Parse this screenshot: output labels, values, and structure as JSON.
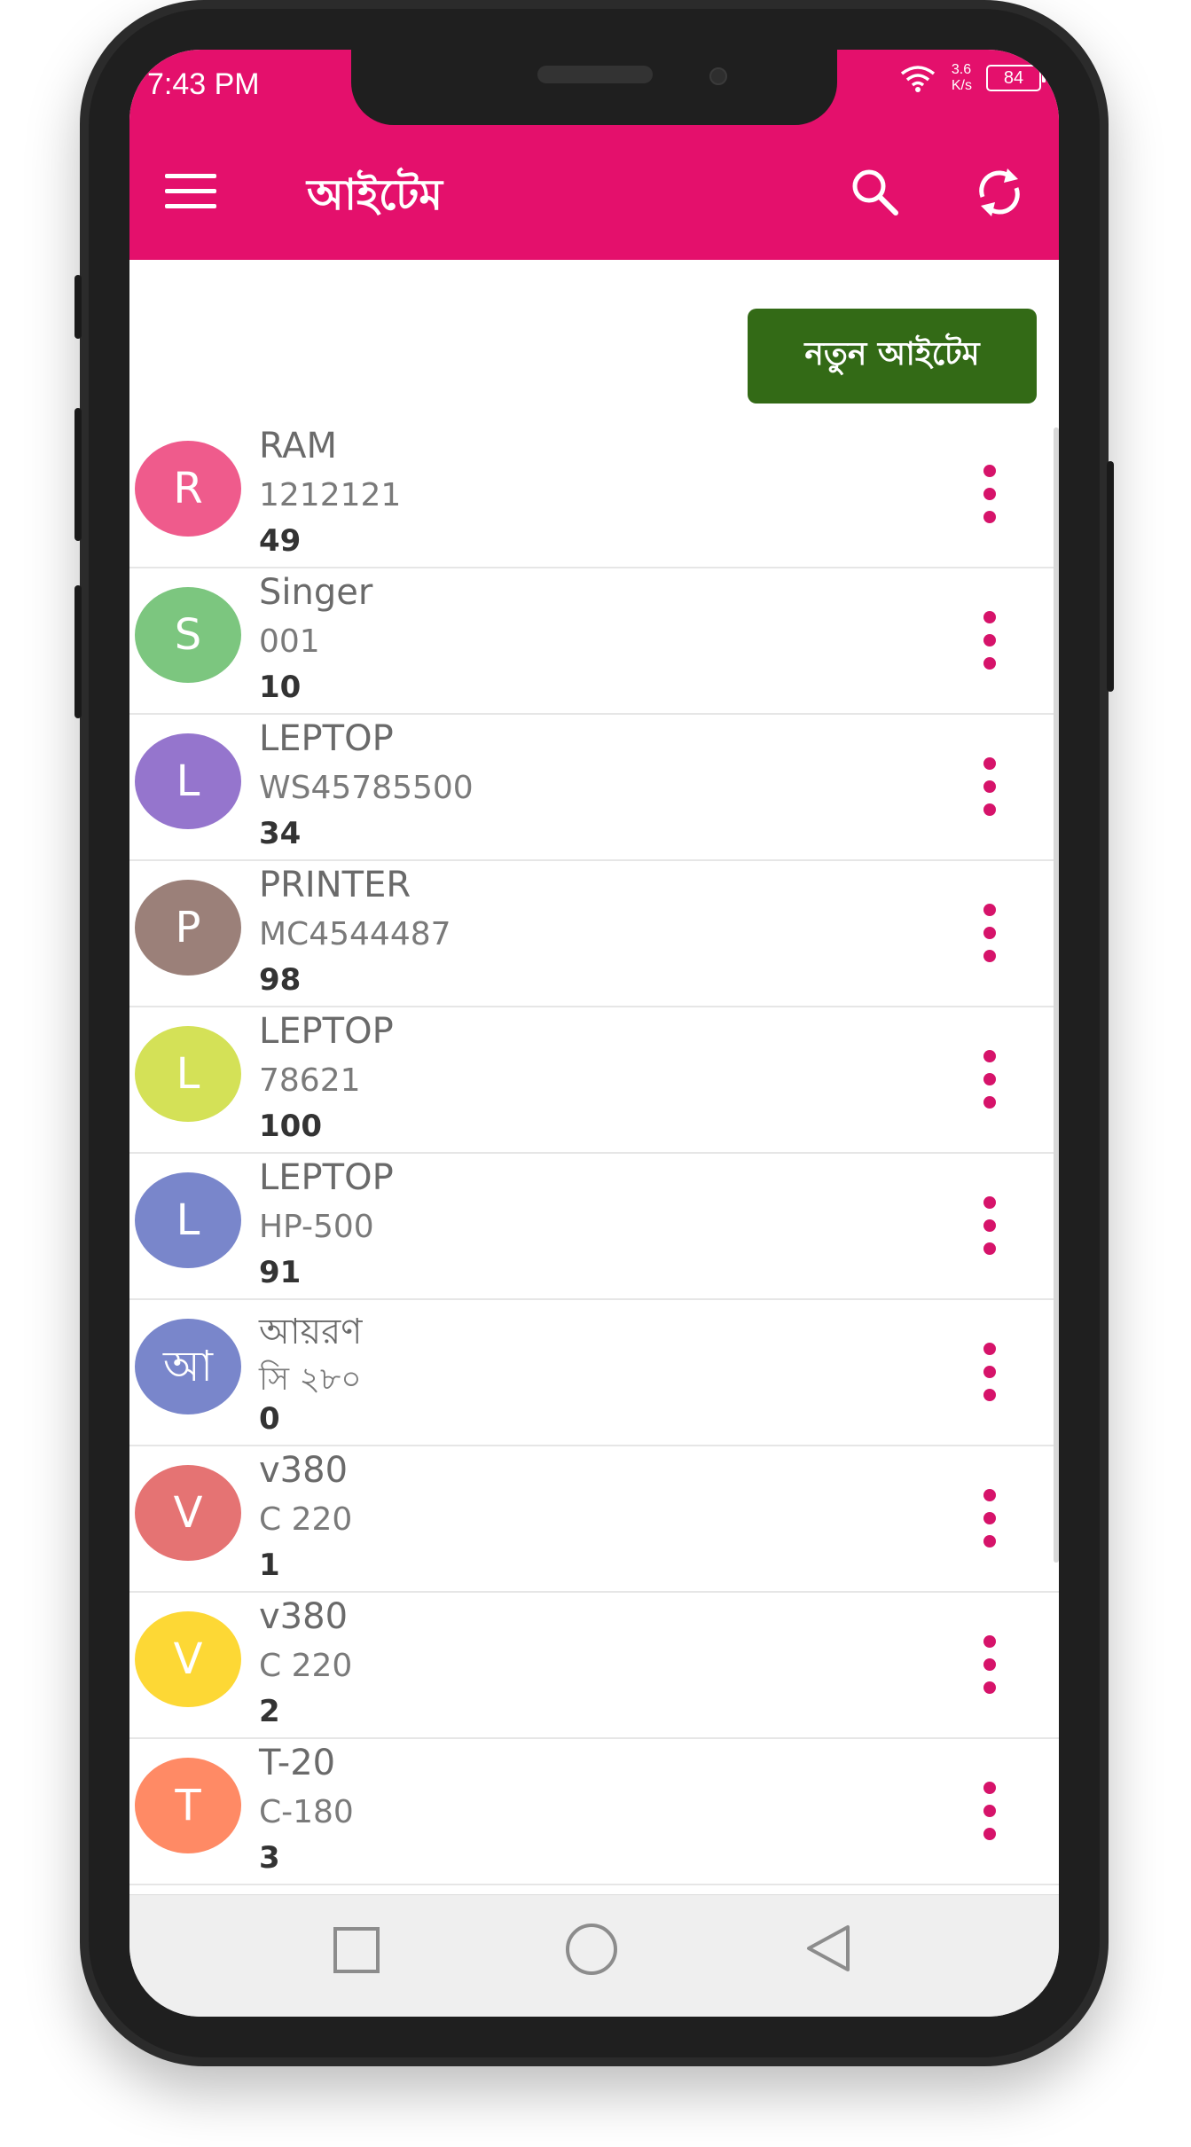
{
  "status_bar": {
    "time": "7:43 PM",
    "speed_value": "3.6",
    "speed_unit": "K/s",
    "battery": "84"
  },
  "header": {
    "title": "আইটেম",
    "menu_icon": "hamburger-menu-icon",
    "search_icon": "search-icon",
    "refresh_icon": "sync-icon",
    "color": "#e4106c"
  },
  "actions": {
    "new_item_label": "নতুন আইটেম",
    "new_item_color": "#336a16"
  },
  "items": [
    {
      "initial": "R",
      "name": "RAM",
      "code": "1212121",
      "qty": "49",
      "color": "#ef5b8c"
    },
    {
      "initial": "S",
      "name": "Singer",
      "code": "001",
      "qty": "10",
      "color": "#7cc67f"
    },
    {
      "initial": "L",
      "name": "LEPTOP",
      "code": "WS45785500",
      "qty": "34",
      "color": "#9575cd"
    },
    {
      "initial": "P",
      "name": "PRINTER",
      "code": "MC4544487",
      "qty": "98",
      "color": "#9b8079"
    },
    {
      "initial": "L",
      "name": "LEPTOP",
      "code": "78621",
      "qty": "100",
      "color": "#d4e157"
    },
    {
      "initial": "L",
      "name": "LEPTOP",
      "code": "HP-500",
      "qty": "91",
      "color": "#7986cb"
    },
    {
      "initial": "আ",
      "name": "আয়রণ",
      "code": "সি ২৮০",
      "qty": "0",
      "color": "#7986cb"
    },
    {
      "initial": "V",
      "name": "v380",
      "code": "C 220",
      "qty": "1",
      "color": "#e57373"
    },
    {
      "initial": "V",
      "name": "v380",
      "code": "C 220",
      "qty": "2",
      "color": "#fdd835"
    },
    {
      "initial": "T",
      "name": "T-20",
      "code": "C-180",
      "qty": "3",
      "color": "#ff8a65"
    }
  ],
  "accent_color": "#d6136a",
  "system_nav": {
    "recent_icon": "square-icon",
    "home_icon": "circle-icon",
    "back_icon": "triangle-back-icon"
  }
}
